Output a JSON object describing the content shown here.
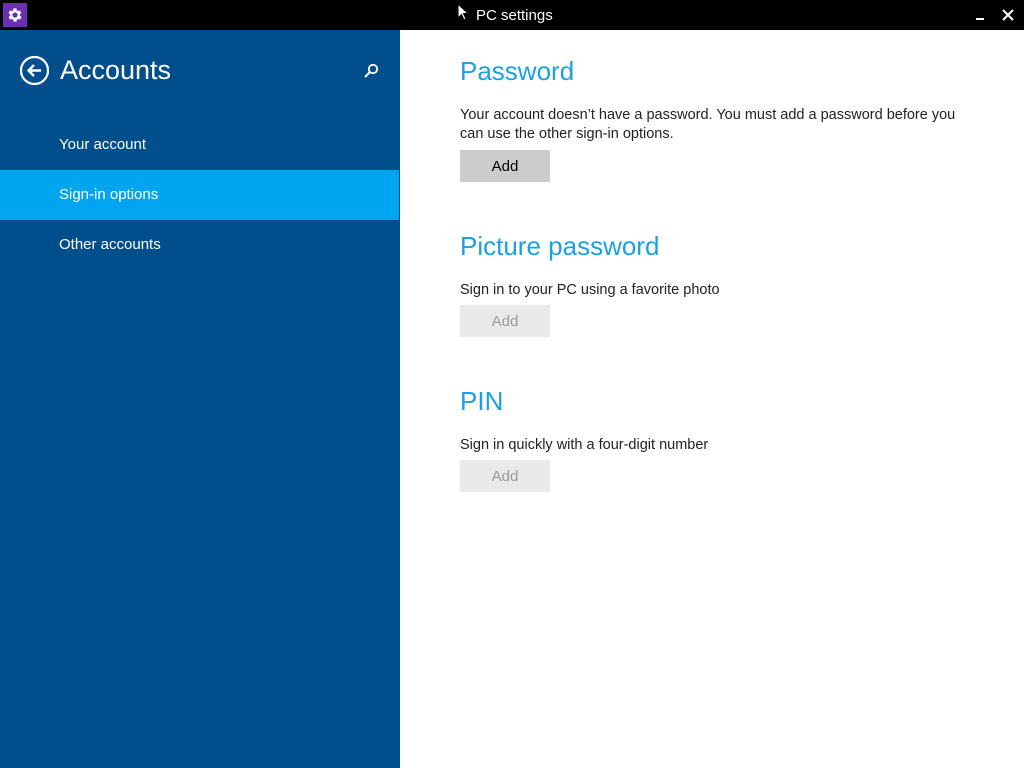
{
  "window": {
    "title": "PC settings",
    "app_icon": "gear-icon",
    "minimize_icon": "minimize-icon",
    "close_icon": "close-icon"
  },
  "sidebar": {
    "title": "Accounts",
    "back_icon": "back-arrow-icon",
    "search_icon": "search-icon",
    "items": [
      {
        "label": "Your account",
        "active": false
      },
      {
        "label": "Sign-in options",
        "active": true
      },
      {
        "label": "Other accounts",
        "active": false
      }
    ]
  },
  "main": {
    "sections": [
      {
        "heading": "Password",
        "description": "Your account doesn’t have a password. You must add a password before you can use the other sign-in options.",
        "button_label": "Add",
        "button_enabled": true
      },
      {
        "heading": "Picture password",
        "description": "Sign in to your PC using a favorite photo",
        "button_label": "Add",
        "button_enabled": false
      },
      {
        "heading": "PIN",
        "description": "Sign in quickly with a four-digit number",
        "button_label": "Add",
        "button_enabled": false
      }
    ]
  },
  "colors": {
    "sidebar_bg": "#004e8c",
    "active_item_bg": "#00a5f0",
    "heading_accent": "#1ba1e2",
    "titlebar_bg": "#000000",
    "app_icon_bg": "#6a2fb4"
  }
}
